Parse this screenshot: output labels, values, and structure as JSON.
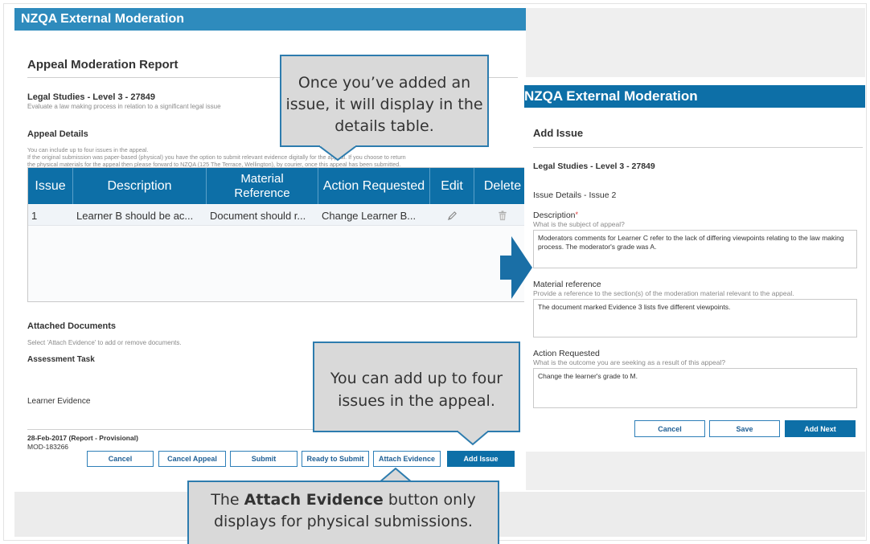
{
  "left_panel": {
    "header_title": "NZQA External Moderation",
    "page_title": "Appeal Moderation Report",
    "course_title": "Legal Studies - Level 3 - 27849",
    "course_description": "Evaluate a law making process in relation to a significant legal issue",
    "appeal_details_heading": "Appeal Details",
    "appeal_info_line1": "You can include up to four issues in the appeal.",
    "appeal_info_line2": "If the original submission was paper-based (physical) you have the option to submit relevant evidence digitally for the appeal. If you choose to return",
    "appeal_info_line3": "the physical materials for the appeal then please forward to NZQA (125 The Terrace, Wellington), by courier, once this appeal has been submitted.",
    "table": {
      "headers": [
        "Issue",
        "Description",
        "Material Reference",
        "Action Requested",
        "Edit",
        "Delete"
      ],
      "rows": [
        {
          "issue": "1",
          "description": "Learner B should be ac...",
          "material_reference": "Document should r...",
          "action_requested": "Change Learner B..."
        }
      ]
    },
    "attached_heading": "Attached Documents",
    "attached_hint": "Select 'Attach Evidence' to add or remove documents.",
    "assessment_task_label": "Assessment Task",
    "learner_evidence_label": "Learner Evidence",
    "report_date": "28-Feb-2017 (Report - Provisional)",
    "moderation_id": "MOD-183266",
    "buttons": {
      "cancel": "Cancel",
      "cancel_appeal": "Cancel Appeal",
      "submit": "Submit",
      "ready_to_submit": "Ready to Submit",
      "attach_evidence": "Attach Evidence",
      "add_issue": "Add Issue"
    }
  },
  "right_panel": {
    "header_title": "NZQA External Moderation",
    "page_title": "Add Issue",
    "course_title": "Legal Studies - Level 3 - 27849",
    "issue_details": "Issue Details - Issue 2",
    "description_label": "Description",
    "required_marker": "*",
    "description_hint": "What is the subject of appeal?",
    "description_value": "Moderators comments for Learner C refer to the lack of differing viewpoints relating to the law making process. The moderator's grade was A.",
    "material_label": "Material reference",
    "material_hint": "Provide a reference to the section(s) of the moderation material relevant to the appeal.",
    "material_value": "The document marked Evidence 3 lists five different viewpoints.",
    "action_label": "Action Requested",
    "action_hint": "What is the outcome you are seeking as a result of this appeal?",
    "action_value": "Change the learner's grade to M.",
    "buttons": {
      "cancel": "Cancel",
      "save": "Save",
      "add_next": "Add Next"
    }
  },
  "callouts": {
    "top_line1": "Once you’ve added an",
    "top_line2": "issue, it will display in the",
    "top_line3": "details table.",
    "middle_line1": "You can add up to four",
    "middle_line2": "issues in the appeal.",
    "bottom_prefix": "The ",
    "bottom_bold": "Attach Evidence",
    "bottom_suffix": " button only",
    "bottom_line2": "displays for physical submissions."
  },
  "icons": {
    "edit": "pencil-icon",
    "delete": "trash-icon",
    "transition_arrow": "right-arrow-icon"
  },
  "colors": {
    "header_blue": "#0d6fa7",
    "light_header_blue": "#2e8bbd",
    "callout_border": "#2d7cae",
    "callout_fill": "#d9d9d9",
    "required_red": "#d33333"
  }
}
